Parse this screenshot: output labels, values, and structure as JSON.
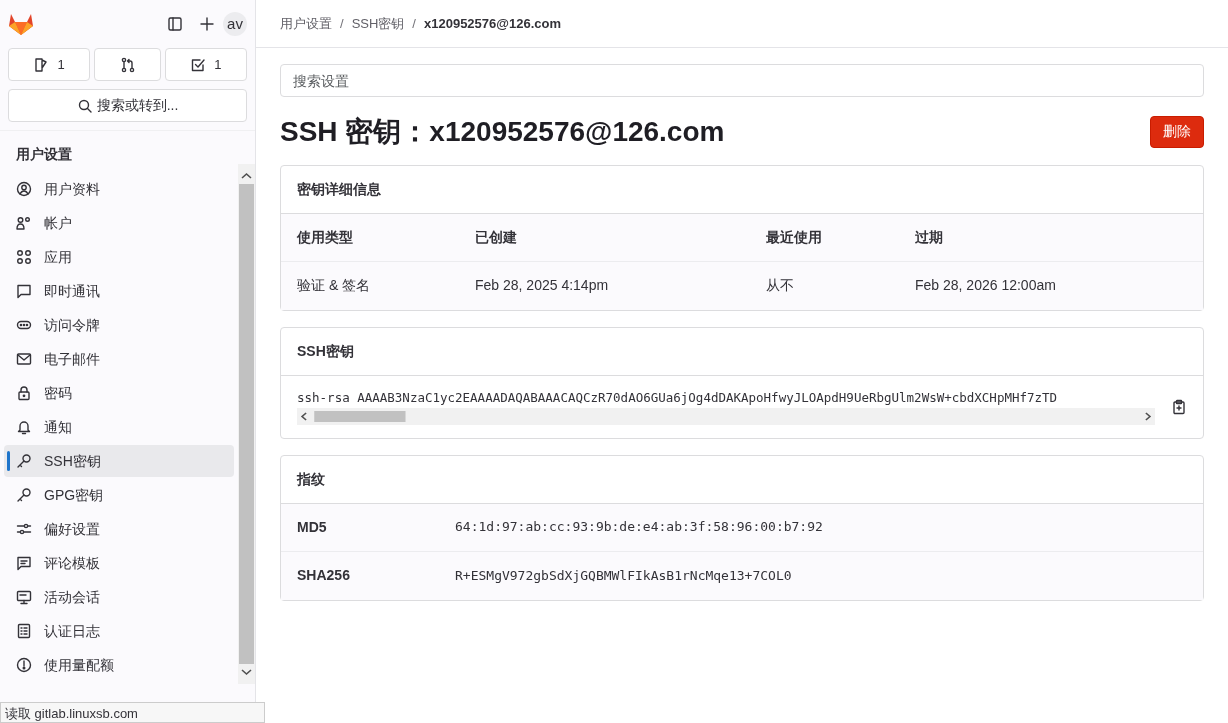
{
  "sidebar": {
    "counters": [
      {
        "kind": "issues",
        "label": "1"
      },
      {
        "kind": "merge_requests"
      },
      {
        "kind": "todos",
        "label": "1"
      }
    ],
    "search_button": "搜索或转到...",
    "avatar": "av",
    "section_title": "用户设置",
    "items": [
      {
        "label": "用户资料",
        "selected": false
      },
      {
        "label": "帐户",
        "selected": false
      },
      {
        "label": "应用",
        "selected": false
      },
      {
        "label": "即时通讯",
        "selected": false
      },
      {
        "label": "访问令牌",
        "selected": false
      },
      {
        "label": "电子邮件",
        "selected": false
      },
      {
        "label": "密码",
        "selected": false
      },
      {
        "label": "通知",
        "selected": false
      },
      {
        "label": "SSH密钥",
        "selected": true
      },
      {
        "label": "GPG密钥",
        "selected": false
      },
      {
        "label": "偏好设置",
        "selected": false
      },
      {
        "label": "评论模板",
        "selected": false
      },
      {
        "label": "活动会话",
        "selected": false
      },
      {
        "label": "认证日志",
        "selected": false
      },
      {
        "label": "使用量配额",
        "selected": false
      }
    ]
  },
  "breadcrumb": {
    "separator": "/",
    "items": [
      "用户设置",
      "SSH密钥",
      "x120952576@126.com"
    ]
  },
  "search": {
    "placeholder": "搜索设置"
  },
  "title": "SSH 密钥：x120952576@126.com",
  "delete_button": "删除",
  "details": {
    "title": "密钥详细信息",
    "columns": [
      "使用类型",
      "已创建",
      "最近使用",
      "过期"
    ],
    "row": [
      "验证 & 签名",
      "Feb 28, 2025 4:14pm",
      "从不",
      "Feb 28, 2026 12:00am"
    ]
  },
  "key": {
    "title": "SSH密钥",
    "value": "ssh-rsa AAAAB3NzaC1yc2EAAAADAQABAAACAQCzR70dAO6GUa6jOg4dDAKApoHfwyJLOApdH9UeRbgUlm2WsW+cbdXCHpMHf7zTD"
  },
  "fingerprints": {
    "title": "指纹",
    "rows": [
      {
        "name": "MD5",
        "value": "64:1d:97:ab:cc:93:9b:de:e4:ab:3f:58:96:00:b7:92"
      },
      {
        "name": "SHA256",
        "value": "R+ESMgV972gbSdXjGQBMWlFIkAsB1rNcMqe13+7COL0"
      }
    ]
  },
  "status_bar": "读取 gitlab.linuxsb.com"
}
